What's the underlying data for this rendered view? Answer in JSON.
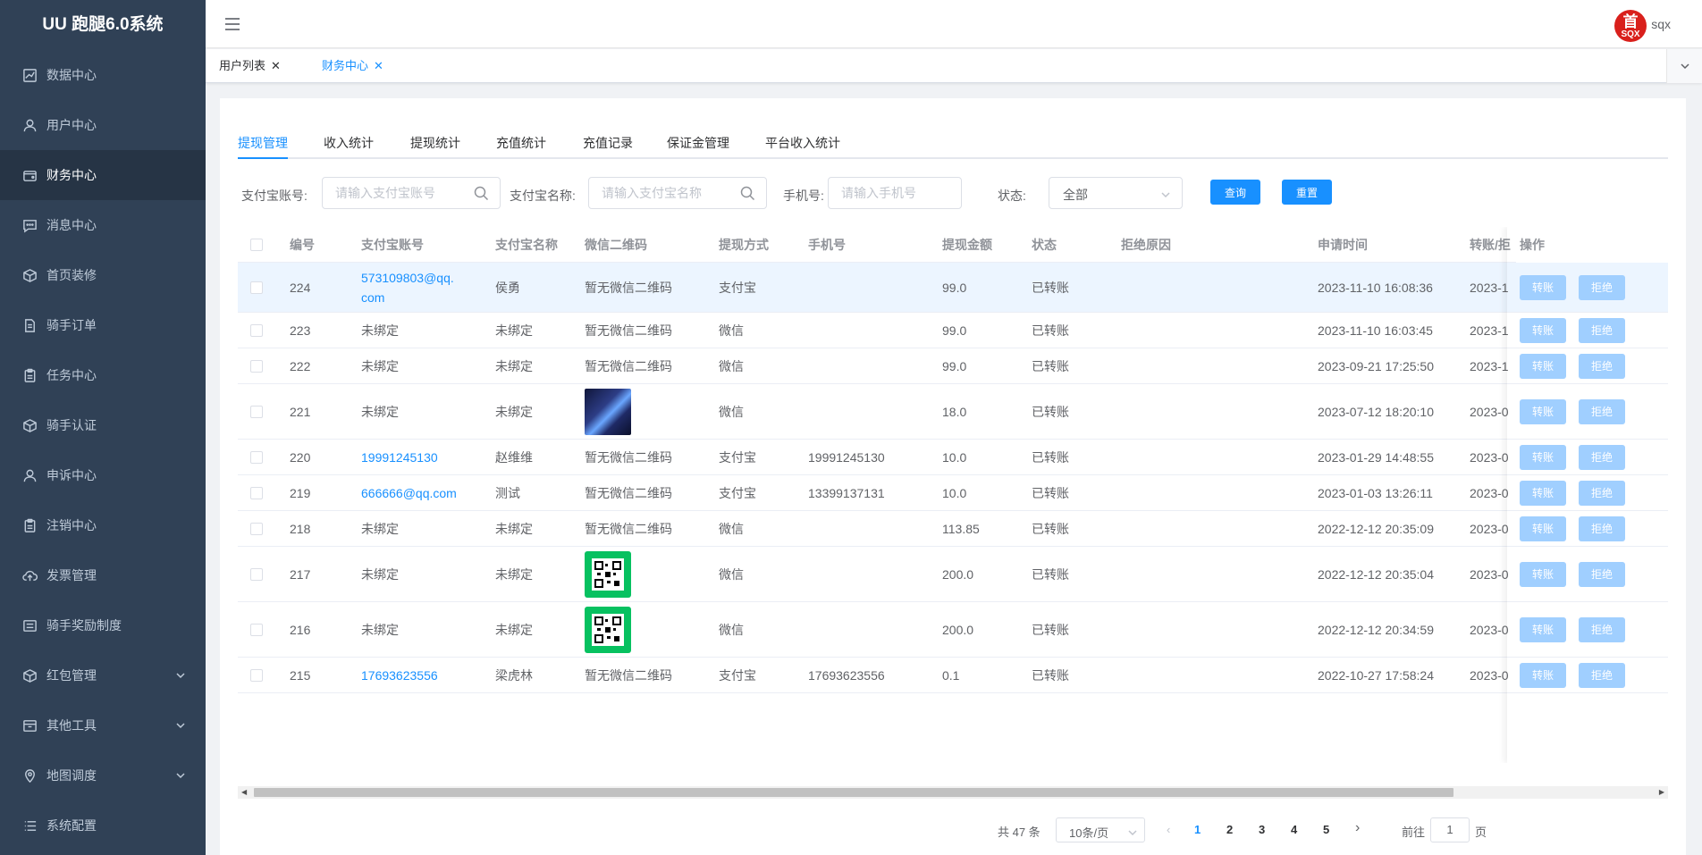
{
  "app": {
    "title": "UU 跑腿6.0系统"
  },
  "sidebar": {
    "items": [
      {
        "label": "数据中心",
        "icon": "chart-icon"
      },
      {
        "label": "用户中心",
        "icon": "user-icon"
      },
      {
        "label": "财务中心",
        "icon": "wallet-icon",
        "active": true
      },
      {
        "label": "消息中心",
        "icon": "message-icon"
      },
      {
        "label": "首页装修",
        "icon": "box-icon"
      },
      {
        "label": "骑手订单",
        "icon": "document-icon"
      },
      {
        "label": "任务中心",
        "icon": "clipboard-icon"
      },
      {
        "label": "骑手认证",
        "icon": "box-icon"
      },
      {
        "label": "申诉中心",
        "icon": "user-icon"
      },
      {
        "label": "注销中心",
        "icon": "clipboard-icon"
      },
      {
        "label": "发票管理",
        "icon": "cloud-upload-icon"
      },
      {
        "label": "骑手奖励制度",
        "icon": "list-icon"
      },
      {
        "label": "红包管理",
        "icon": "box-icon",
        "expandable": true
      },
      {
        "label": "其他工具",
        "icon": "folder-icon",
        "expandable": true
      },
      {
        "label": "地图调度",
        "icon": "location-icon",
        "expandable": true
      },
      {
        "label": "系统配置",
        "icon": "menu-list-icon"
      }
    ]
  },
  "header": {
    "avatar_text": "首",
    "avatar_subtext": "SQX",
    "username": "sqx"
  },
  "tags": [
    {
      "label": "用户列表",
      "active": false
    },
    {
      "label": "财务中心",
      "active": true
    }
  ],
  "tabs": [
    "提现管理",
    "收入统计",
    "提现统计",
    "充值统计",
    "充值记录",
    "保证金管理",
    "平台收入统计"
  ],
  "filters": {
    "alipay_account_label": "支付宝账号:",
    "alipay_account_placeholder": "请输入支付宝账号",
    "alipay_name_label": "支付宝名称:",
    "alipay_name_placeholder": "请输入支付宝名称",
    "phone_label": "手机号:",
    "phone_placeholder": "请输入手机号",
    "status_label": "状态:",
    "status_value": "全部",
    "query_button": "查询",
    "reset_button": "重置"
  },
  "table": {
    "columns": [
      "编号",
      "支付宝账号",
      "支付宝名称",
      "微信二维码",
      "提现方式",
      "手机号",
      "提现金额",
      "状态",
      "拒绝原因",
      "申请时间",
      "转账/拒",
      "操作"
    ],
    "actions": {
      "transfer": "转账",
      "reject": "拒绝"
    },
    "rows": [
      {
        "id": "224",
        "account": "573109803@qq.com",
        "account_link": true,
        "name": "侯勇",
        "qr": "暂无微信二维码",
        "qr_type": "text",
        "method": "支付宝",
        "phone": "",
        "amount": "99.0",
        "status": "已转账",
        "reason": "",
        "time": "2023-11-10 16:08:36",
        "transfer_time": "2023-1",
        "highlight": true
      },
      {
        "id": "223",
        "account": "未绑定",
        "account_link": false,
        "name": "未绑定",
        "qr": "暂无微信二维码",
        "qr_type": "text",
        "method": "微信",
        "phone": "",
        "amount": "99.0",
        "status": "已转账",
        "reason": "",
        "time": "2023-11-10 16:03:45",
        "transfer_time": "2023-1"
      },
      {
        "id": "222",
        "account": "未绑定",
        "account_link": false,
        "name": "未绑定",
        "qr": "暂无微信二维码",
        "qr_type": "text",
        "method": "微信",
        "phone": "",
        "amount": "99.0",
        "status": "已转账",
        "reason": "",
        "time": "2023-09-21 17:25:50",
        "transfer_time": "2023-1"
      },
      {
        "id": "221",
        "account": "未绑定",
        "account_link": false,
        "name": "未绑定",
        "qr": "",
        "qr_type": "avatar",
        "method": "微信",
        "phone": "",
        "amount": "18.0",
        "status": "已转账",
        "reason": "",
        "time": "2023-07-12 18:20:10",
        "transfer_time": "2023-0"
      },
      {
        "id": "220",
        "account": "19991245130",
        "account_link": true,
        "name": "赵维维",
        "qr": "暂无微信二维码",
        "qr_type": "text",
        "method": "支付宝",
        "phone": "19991245130",
        "amount": "10.0",
        "status": "已转账",
        "reason": "",
        "time": "2023-01-29 14:48:55",
        "transfer_time": "2023-0"
      },
      {
        "id": "219",
        "account": "666666@qq.com",
        "account_link": true,
        "name": "测试",
        "qr": "暂无微信二维码",
        "qr_type": "text",
        "method": "支付宝",
        "phone": "13399137131",
        "amount": "10.0",
        "status": "已转账",
        "reason": "",
        "time": "2023-01-03 13:26:11",
        "transfer_time": "2023-0"
      },
      {
        "id": "218",
        "account": "未绑定",
        "account_link": false,
        "name": "未绑定",
        "qr": "暂无微信二维码",
        "qr_type": "text",
        "method": "微信",
        "phone": "",
        "amount": "113.85",
        "status": "已转账",
        "reason": "",
        "time": "2022-12-12 20:35:09",
        "transfer_time": "2023-0"
      },
      {
        "id": "217",
        "account": "未绑定",
        "account_link": false,
        "name": "未绑定",
        "qr": "",
        "qr_type": "qrcode",
        "method": "微信",
        "phone": "",
        "amount": "200.0",
        "status": "已转账",
        "reason": "",
        "time": "2022-12-12 20:35:04",
        "transfer_time": "2023-0"
      },
      {
        "id": "216",
        "account": "未绑定",
        "account_link": false,
        "name": "未绑定",
        "qr": "",
        "qr_type": "qrcode",
        "method": "微信",
        "phone": "",
        "amount": "200.0",
        "status": "已转账",
        "reason": "",
        "time": "2022-12-12 20:34:59",
        "transfer_time": "2023-0"
      },
      {
        "id": "215",
        "account": "17693623556",
        "account_link": true,
        "name": "梁虎林",
        "qr": "暂无微信二维码",
        "qr_type": "text",
        "method": "支付宝",
        "phone": "17693623556",
        "amount": "0.1",
        "status": "已转账",
        "reason": "",
        "time": "2022-10-27 17:58:24",
        "transfer_time": "2023-0"
      }
    ]
  },
  "pagination": {
    "total": "共 47 条",
    "page_size": "10条/页",
    "pages": [
      "1",
      "2",
      "3",
      "4",
      "5"
    ],
    "current_page": "1",
    "goto_prefix": "前往",
    "goto_value": "1",
    "goto_suffix": "页"
  },
  "colors": {
    "sidebar_bg": "#304156",
    "primary": "#1890ff",
    "disabled_button": "#a0cfff",
    "wechat_green": "#07c160"
  }
}
